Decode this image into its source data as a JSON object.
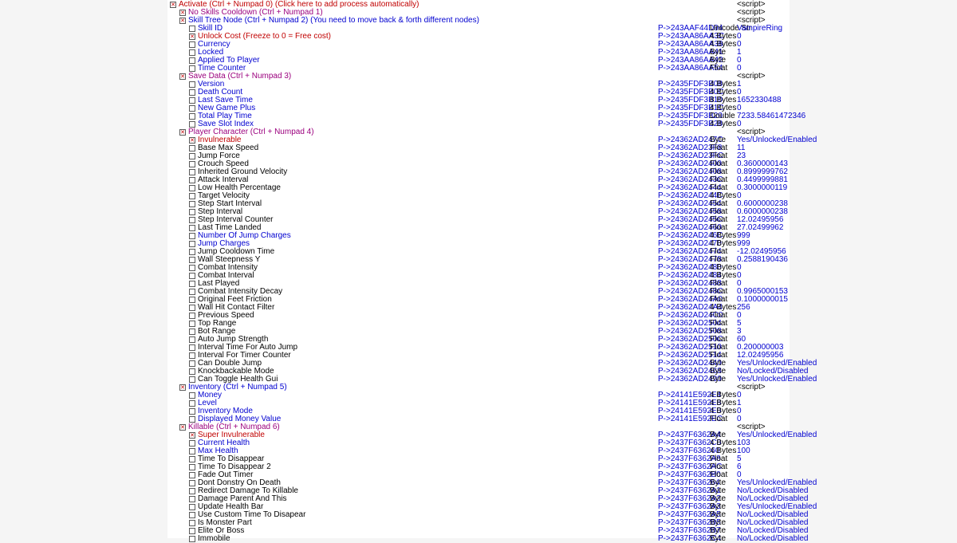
{
  "script_label": "<script>",
  "rows": [
    {
      "indent": 0,
      "checked": true,
      "desc": "Activate (Ctrl + Numpad 0) (Click here to add process automatically)",
      "dcolor": "red",
      "val": "<script>",
      "vcol": "type"
    },
    {
      "indent": 1,
      "checked": true,
      "desc": "No Skills Cooldown (Ctrl + Numpad 1)",
      "dcolor": "purple",
      "val": "<script>",
      "vcol": "type"
    },
    {
      "indent": 1,
      "checked": true,
      "desc": "Skill Tree Node (Ctrl + Numpad 2) (You need to move back & forth different nodes)",
      "dcolor": "blue",
      "val": "<script>",
      "vcol": "type"
    },
    {
      "indent": 2,
      "checked": false,
      "desc": "Skill ID",
      "dcolor": "blue",
      "addr": "P->243AAF44D94",
      "type": "Unicode Str",
      "val": "VampireRing"
    },
    {
      "indent": 2,
      "checked": true,
      "desc": "Unlock Cost (Freeze to 0 = Free cost)",
      "dcolor": "red",
      "addr": "P->243AA86AA3C",
      "type": "4 Bytes",
      "val": "0"
    },
    {
      "indent": 2,
      "checked": false,
      "desc": "Currency",
      "dcolor": "blue",
      "addr": "P->243AA86AA38",
      "type": "4 Bytes",
      "val": "0"
    },
    {
      "indent": 2,
      "checked": false,
      "desc": "Locked",
      "dcolor": "blue",
      "addr": "P->243AA86AA41",
      "type": "Byte",
      "val": "1"
    },
    {
      "indent": 2,
      "checked": false,
      "desc": "Applied To Player",
      "dcolor": "blue",
      "addr": "P->243AA86AA42",
      "type": "Byte",
      "val": "0"
    },
    {
      "indent": 2,
      "checked": false,
      "desc": "Time Counter",
      "dcolor": "blue",
      "addr": "P->243AA86AA54",
      "type": "Float",
      "val": "0"
    },
    {
      "indent": 1,
      "checked": true,
      "desc": "Save Data (Ctrl + Numpad 3)",
      "dcolor": "purple",
      "val": "<script>",
      "vcol": "type"
    },
    {
      "indent": 2,
      "checked": false,
      "desc": "Version",
      "dcolor": "blue",
      "addr": "P->2435FDF3B08",
      "type": "4 Bytes",
      "val": "1"
    },
    {
      "indent": 2,
      "checked": false,
      "desc": "Death Count",
      "dcolor": "blue",
      "addr": "P->2435FDF3B0C",
      "type": "4 Bytes",
      "val": "0"
    },
    {
      "indent": 2,
      "checked": false,
      "desc": "Last Save Time",
      "dcolor": "blue",
      "addr": "P->2435FDF3B10",
      "type": "8 Bytes",
      "val": "1652330488"
    },
    {
      "indent": 2,
      "checked": false,
      "desc": "New Game Plus",
      "dcolor": "blue",
      "addr": "P->2435FDF3B1C",
      "type": "4 Bytes",
      "val": "0"
    },
    {
      "indent": 2,
      "checked": false,
      "desc": "Total Play Time",
      "dcolor": "blue",
      "addr": "P->2435FDF3B20",
      "type": "Double",
      "val": "7233.58461472346"
    },
    {
      "indent": 2,
      "checked": false,
      "desc": "Save Slot Index",
      "dcolor": "blue",
      "addr": "P->2435FDF3B28",
      "type": "4 Bytes",
      "val": "0"
    },
    {
      "indent": 1,
      "checked": true,
      "desc": "Player Character (Ctrl + Numpad 4)",
      "dcolor": "purple",
      "val": "<script>",
      "vcol": "type"
    },
    {
      "indent": 2,
      "checked": true,
      "desc": "Invulnerable",
      "dcolor": "red",
      "addr": "P->24362AD247C",
      "type": "Byte",
      "val": "Yes/Unlocked/Enabled"
    },
    {
      "indent": 2,
      "checked": false,
      "desc": "Base Max Speed",
      "addr": "P->24362AD23F8",
      "type": "Float",
      "val": "11"
    },
    {
      "indent": 2,
      "checked": false,
      "desc": "Jump Force",
      "addr": "P->24362AD23FC",
      "type": "Float",
      "val": "23"
    },
    {
      "indent": 2,
      "checked": false,
      "desc": "Crouch Speed",
      "addr": "P->24362AD2400",
      "type": "Float",
      "val": "0.3600000143"
    },
    {
      "indent": 2,
      "checked": false,
      "desc": "Inherited Ground Velocity",
      "addr": "P->24362AD2408",
      "type": "Float",
      "val": "0.8999999762"
    },
    {
      "indent": 2,
      "checked": false,
      "desc": "Attack Interval",
      "addr": "P->24362AD243C",
      "type": "Float",
      "val": "0.4499999881"
    },
    {
      "indent": 2,
      "checked": false,
      "desc": "Low Health Percentage",
      "addr": "P->24362AD2444",
      "type": "Float",
      "val": "0.3000000119"
    },
    {
      "indent": 2,
      "checked": false,
      "desc": "Target Velocity",
      "addr": "P->24362AD244C",
      "type": "4 Bytes",
      "val": "0"
    },
    {
      "indent": 2,
      "checked": false,
      "desc": "Step Start Interval",
      "addr": "P->24362AD2454",
      "type": "Float",
      "val": "0.6000000238"
    },
    {
      "indent": 2,
      "checked": false,
      "desc": "Step Interval",
      "addr": "P->24362AD2458",
      "type": "Float",
      "val": "0.6000000238"
    },
    {
      "indent": 2,
      "checked": false,
      "desc": "Step Interval Counter",
      "addr": "P->24362AD245C",
      "type": "Float",
      "val": "12.02495956"
    },
    {
      "indent": 2,
      "checked": false,
      "desc": "Last Time Landed",
      "addr": "P->24362AD2460",
      "type": "Float",
      "val": "27.02499962"
    },
    {
      "indent": 2,
      "checked": false,
      "desc": "Number Of Jump Charges",
      "dcolor": "blue",
      "addr": "P->24362AD246C",
      "type": "4 Bytes",
      "val": "999"
    },
    {
      "indent": 2,
      "checked": false,
      "desc": "Jump Charges",
      "dcolor": "blue",
      "addr": "P->24362AD2470",
      "type": "4 Bytes",
      "val": "999"
    },
    {
      "indent": 2,
      "checked": false,
      "desc": "Jump Cooldown Time",
      "addr": "P->24362AD2474",
      "type": "Float",
      "val": "-12.02495956"
    },
    {
      "indent": 2,
      "checked": false,
      "desc": "Wall Steepness Y",
      "addr": "P->24362AD2478",
      "type": "Float",
      "val": "0.2588190436"
    },
    {
      "indent": 2,
      "checked": false,
      "desc": "Combat Intensity",
      "addr": "P->24362AD2480",
      "type": "4 Bytes",
      "val": "0"
    },
    {
      "indent": 2,
      "checked": false,
      "desc": "Combat Interval",
      "addr": "P->24362AD2484",
      "type": "4 Bytes",
      "val": "0"
    },
    {
      "indent": 2,
      "checked": false,
      "desc": "Last Played",
      "addr": "P->24362AD2488",
      "type": "Float",
      "val": "0"
    },
    {
      "indent": 2,
      "checked": false,
      "desc": "Combat Intensity Decay",
      "addr": "P->24362AD248C",
      "type": "Float",
      "val": "0.9965000153"
    },
    {
      "indent": 2,
      "checked": false,
      "desc": "Original Feet Friction",
      "addr": "P->24362AD24A0",
      "type": "Float",
      "val": "0.1000000015"
    },
    {
      "indent": 2,
      "checked": false,
      "desc": "Wall Hit Contact Filter",
      "addr": "P->24362AD24A4",
      "type": "4 Bytes",
      "val": "256"
    },
    {
      "indent": 2,
      "checked": false,
      "desc": "Previous Speed",
      "addr": "P->24362AD24C0",
      "type": "Float",
      "val": "0"
    },
    {
      "indent": 2,
      "checked": false,
      "desc": "Top Range",
      "addr": "P->24362AD2504",
      "type": "Float",
      "val": "5"
    },
    {
      "indent": 2,
      "checked": false,
      "desc": "Bot Range",
      "addr": "P->24362AD2508",
      "type": "Float",
      "val": "3"
    },
    {
      "indent": 2,
      "checked": false,
      "desc": "Auto Jump Strength",
      "addr": "P->24362AD250C",
      "type": "Float",
      "val": "60"
    },
    {
      "indent": 2,
      "checked": false,
      "desc": "Interval Time For Auto Jump",
      "addr": "P->24362AD2510",
      "type": "Float",
      "val": "0.200000003"
    },
    {
      "indent": 2,
      "checked": false,
      "desc": "Interval For Timer Counter",
      "addr": "P->24362AD2514",
      "type": "Float",
      "val": "12.02495956"
    },
    {
      "indent": 2,
      "checked": false,
      "desc": "Can Double Jump",
      "addr": "P->24362AD2440",
      "type": "Byte",
      "val": "Yes/Unlocked/Enabled"
    },
    {
      "indent": 2,
      "checked": false,
      "desc": "Knockbackable Mode",
      "addr": "P->24362AD2468",
      "type": "Byte",
      "val": "No/Locked/Disabled"
    },
    {
      "indent": 2,
      "checked": false,
      "desc": "Can Toggle Health Gui",
      "addr": "P->24362AD2490",
      "type": "Byte",
      "val": "Yes/Unlocked/Enabled"
    },
    {
      "indent": 1,
      "checked": true,
      "desc": "Inventory (Ctrl + Numpad 5)",
      "dcolor": "blue",
      "val": "<script>",
      "vcol": "type"
    },
    {
      "indent": 2,
      "checked": false,
      "desc": "Money",
      "dcolor": "blue",
      "addr": "P->24141E592E4",
      "type": "4 Bytes",
      "val": "0"
    },
    {
      "indent": 2,
      "checked": false,
      "desc": "Level",
      "dcolor": "blue",
      "addr": "P->24141E592E8",
      "type": "4 Bytes",
      "val": "1"
    },
    {
      "indent": 2,
      "checked": false,
      "desc": "Inventory Mode",
      "dcolor": "blue",
      "addr": "P->24141E592E0",
      "type": "4 Bytes",
      "val": "0"
    },
    {
      "indent": 2,
      "checked": false,
      "desc": "Displayed Money Value",
      "dcolor": "blue",
      "addr": "P->24141E592EC",
      "type": "Float",
      "val": "0"
    },
    {
      "indent": 1,
      "checked": true,
      "desc": "Killable (Ctrl + Numpad 6)",
      "dcolor": "purple",
      "val": "<script>",
      "vcol": "type"
    },
    {
      "indent": 2,
      "checked": true,
      "desc": "Super Invulnerable",
      "dcolor": "red",
      "addr": "P->2437F6362A4",
      "type": "Byte",
      "val": "Yes/Unlocked/Enabled"
    },
    {
      "indent": 2,
      "checked": false,
      "desc": "Current Health",
      "dcolor": "blue",
      "addr": "P->2437F6362C0",
      "type": "4 Bytes",
      "val": "103"
    },
    {
      "indent": 2,
      "checked": false,
      "desc": "Max Health",
      "dcolor": "blue",
      "addr": "P->2437F636260",
      "type": "4 Bytes",
      "val": "100"
    },
    {
      "indent": 2,
      "checked": false,
      "desc": "Time To Disappear",
      "addr": "P->2437F6362A8",
      "type": "Float",
      "val": "5"
    },
    {
      "indent": 2,
      "checked": false,
      "desc": "Time To Disappear 2",
      "addr": "P->2437F6362AC",
      "type": "Float",
      "val": "6"
    },
    {
      "indent": 2,
      "checked": false,
      "desc": "Fade Out Timer",
      "addr": "P->2437F6362B0",
      "type": "Float",
      "val": "0"
    },
    {
      "indent": 2,
      "checked": false,
      "desc": "Dont Donstry On Death",
      "addr": "P->2437F636264",
      "type": "Byte",
      "val": "Yes/Unlocked/Enabled"
    },
    {
      "indent": 2,
      "checked": false,
      "desc": "Redirect Damage To Killable",
      "addr": "P->2437F6362A1",
      "type": "Byte",
      "val": "No/Locked/Disabled"
    },
    {
      "indent": 2,
      "checked": false,
      "desc": "Damage Parent And This",
      "addr": "P->2437F6362A2",
      "type": "Byte",
      "val": "No/Locked/Disabled"
    },
    {
      "indent": 2,
      "checked": false,
      "desc": "Update Health Bar",
      "addr": "P->2437F6362A3",
      "type": "Byte",
      "val": "Yes/Unlocked/Enabled"
    },
    {
      "indent": 2,
      "checked": false,
      "desc": "Use Custom Time To Disapear",
      "addr": "P->2437F6362A5",
      "type": "Byte",
      "val": "No/Locked/Disabled"
    },
    {
      "indent": 2,
      "checked": false,
      "desc": "Is Monster Part",
      "addr": "P->2437F6362B5",
      "type": "Byte",
      "val": "No/Locked/Disabled"
    },
    {
      "indent": 2,
      "checked": false,
      "desc": "Elite Or Boss",
      "addr": "P->2437F6362B7",
      "type": "Byte",
      "val": "No/Locked/Disabled"
    },
    {
      "indent": 2,
      "checked": false,
      "desc": "Immobile",
      "addr": "P->2437F6362C4",
      "type": "Byte",
      "val": "No/Locked/Disabled"
    }
  ]
}
